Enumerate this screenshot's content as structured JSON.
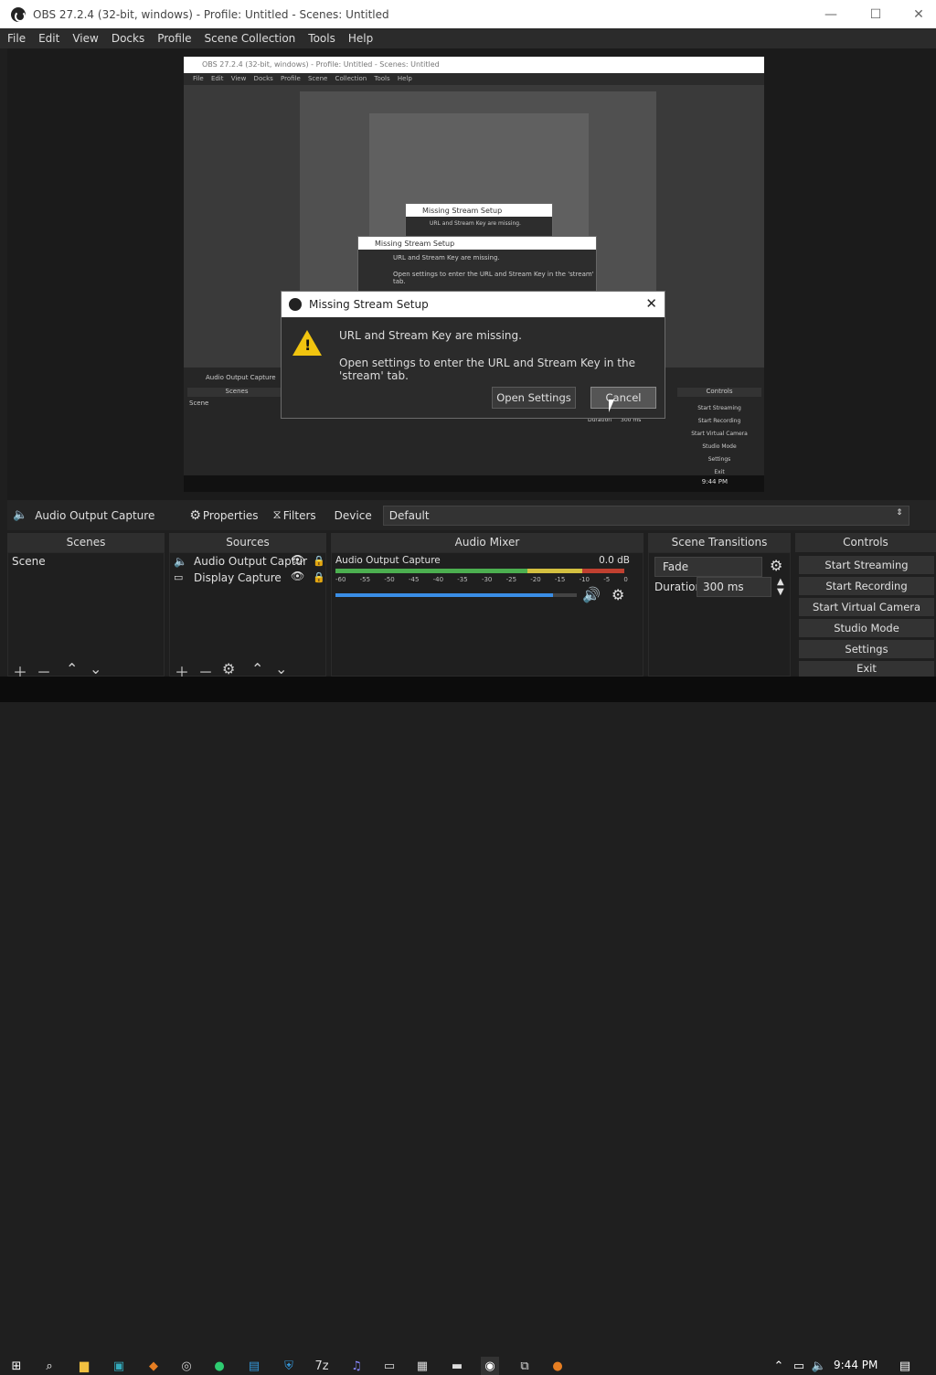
{
  "window": {
    "title": "OBS 27.2.4 (32-bit, windows) - Profile: Untitled - Scenes: Untitled",
    "minimize": "—",
    "maximize": "☐",
    "close": "✕"
  },
  "menu": [
    "File",
    "Edit",
    "View",
    "Docks",
    "Profile",
    "Scene Collection",
    "Tools",
    "Help"
  ],
  "preview": {
    "title": "OBS 27.2.4 (32-bit, windows) - Profile: Untitled - Scenes: Untitled",
    "menu": "File Edit View Docks Profile Scene Collection Tools Help",
    "dialog1_title": "Missing Stream Setup",
    "dialog1_line1": "URL and Stream Key are missing.",
    "dialog1_line2": "Open settings to enter the URL and Stream Key in the 'stream' tab.",
    "dialog2_title": "Missing Stream Setup",
    "dialog2_line1": "URL and Stream Key are missing.",
    "dialog2_line2": "Open settings to enter the URL and Stream Key in the 'stream' tab.",
    "audio_output": "Audio Output Capture",
    "scenes": "Scenes",
    "scene": "Scene",
    "controls": "Controls",
    "start_streaming": "Start Streaming",
    "start_recording": "Start Recording",
    "start_virtual_camera": "Start Virtual Camera",
    "studio_mode": "Studio Mode",
    "settings": "Settings",
    "exit": "Exit",
    "duration_label": "Duration",
    "duration_value": "300 ms",
    "clock": "9:44 PM"
  },
  "dialog": {
    "title": "Missing Stream Setup",
    "line1": "URL and Stream Key are missing.",
    "line2": "Open settings to enter the URL and Stream Key in the 'stream' tab.",
    "open_settings": "Open Settings",
    "cancel": "Cancel"
  },
  "source_toolbar": {
    "source_name": "Audio Output Capture",
    "properties": "Properties",
    "filters": "Filters",
    "device_label": "Device",
    "device_value": "Default"
  },
  "panels": {
    "scenes": {
      "title": "Scenes",
      "items": [
        "Scene"
      ]
    },
    "sources": {
      "title": "Sources",
      "items": [
        "Audio Output Captur",
        "Display Capture"
      ]
    },
    "mixer": {
      "title": "Audio Mixer",
      "track": "Audio Output Capture",
      "level": "0.0 dB",
      "scale": [
        "-60",
        "-55",
        "-50",
        "-45",
        "-40",
        "-35",
        "-30",
        "-25",
        "-20",
        "-15",
        "-10",
        "-5",
        "0"
      ],
      "volume": 0.9
    },
    "transitions": {
      "title": "Scene Transitions",
      "transition": "Fade",
      "duration_label": "Duration",
      "duration_value": "300 ms"
    },
    "controls": {
      "title": "Controls",
      "buttons": [
        "Start Streaming",
        "Start Recording",
        "Start Virtual Camera",
        "Studio Mode",
        "Settings",
        "Exit"
      ]
    }
  },
  "taskbar": {
    "time": "9:44 PM"
  }
}
